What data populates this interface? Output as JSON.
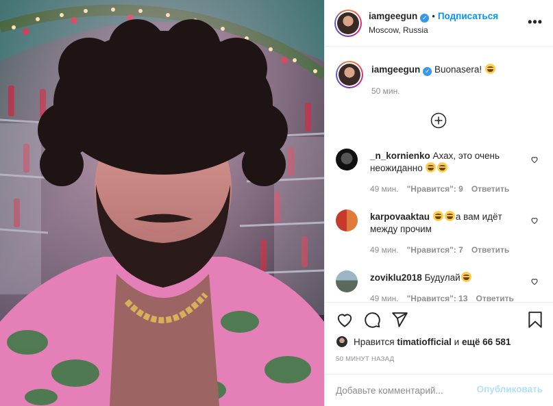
{
  "header": {
    "username": "iamgeegun",
    "separator": "•",
    "follow_label": "Подписаться",
    "location": "Moscow, Russia",
    "more_label": "•••"
  },
  "caption": {
    "username": "iamgeegun",
    "text": "Buonasera!",
    "emoji": "grinning-sweat-emoji",
    "time": "50 мин."
  },
  "comments": [
    {
      "username": "_n_kornienko",
      "text_line1": "Ахах, это очень",
      "text_line2": "неожиданно",
      "time": "49 мин.",
      "likes": "\"Нравится\": 9",
      "reply": "Ответить"
    },
    {
      "username": "karpovaaktau",
      "text_line1": "а вам идёт",
      "text_line2": "между прочим",
      "time": "49 мин.",
      "likes": "\"Нравится\": 7",
      "reply": "Ответить"
    },
    {
      "username": "zoviklu2018",
      "text_line1": "Будулай",
      "time": "49 мин.",
      "likes": "\"Нравится\": 13",
      "reply": "Ответить"
    }
  ],
  "likes": {
    "prefix": "Нравится",
    "user": "timatiofficial",
    "middle": "и",
    "rest": "ещё 66 581"
  },
  "time_ago": "50 минут назад",
  "add_comment": {
    "placeholder": "Добавьте комментарий...",
    "post_label": "Опубликовать"
  },
  "colors": {
    "link_blue": "#0095f6",
    "verified_blue": "#3897f0",
    "post_disabled": "#b2dffc",
    "meta_gray": "#8e8e8e"
  },
  "icons": [
    "verified-badge-icon",
    "more-options-icon",
    "add-comments-icon",
    "heart-icon",
    "comment-icon",
    "share-icon",
    "bookmark-icon",
    "small-heart-icon"
  ]
}
